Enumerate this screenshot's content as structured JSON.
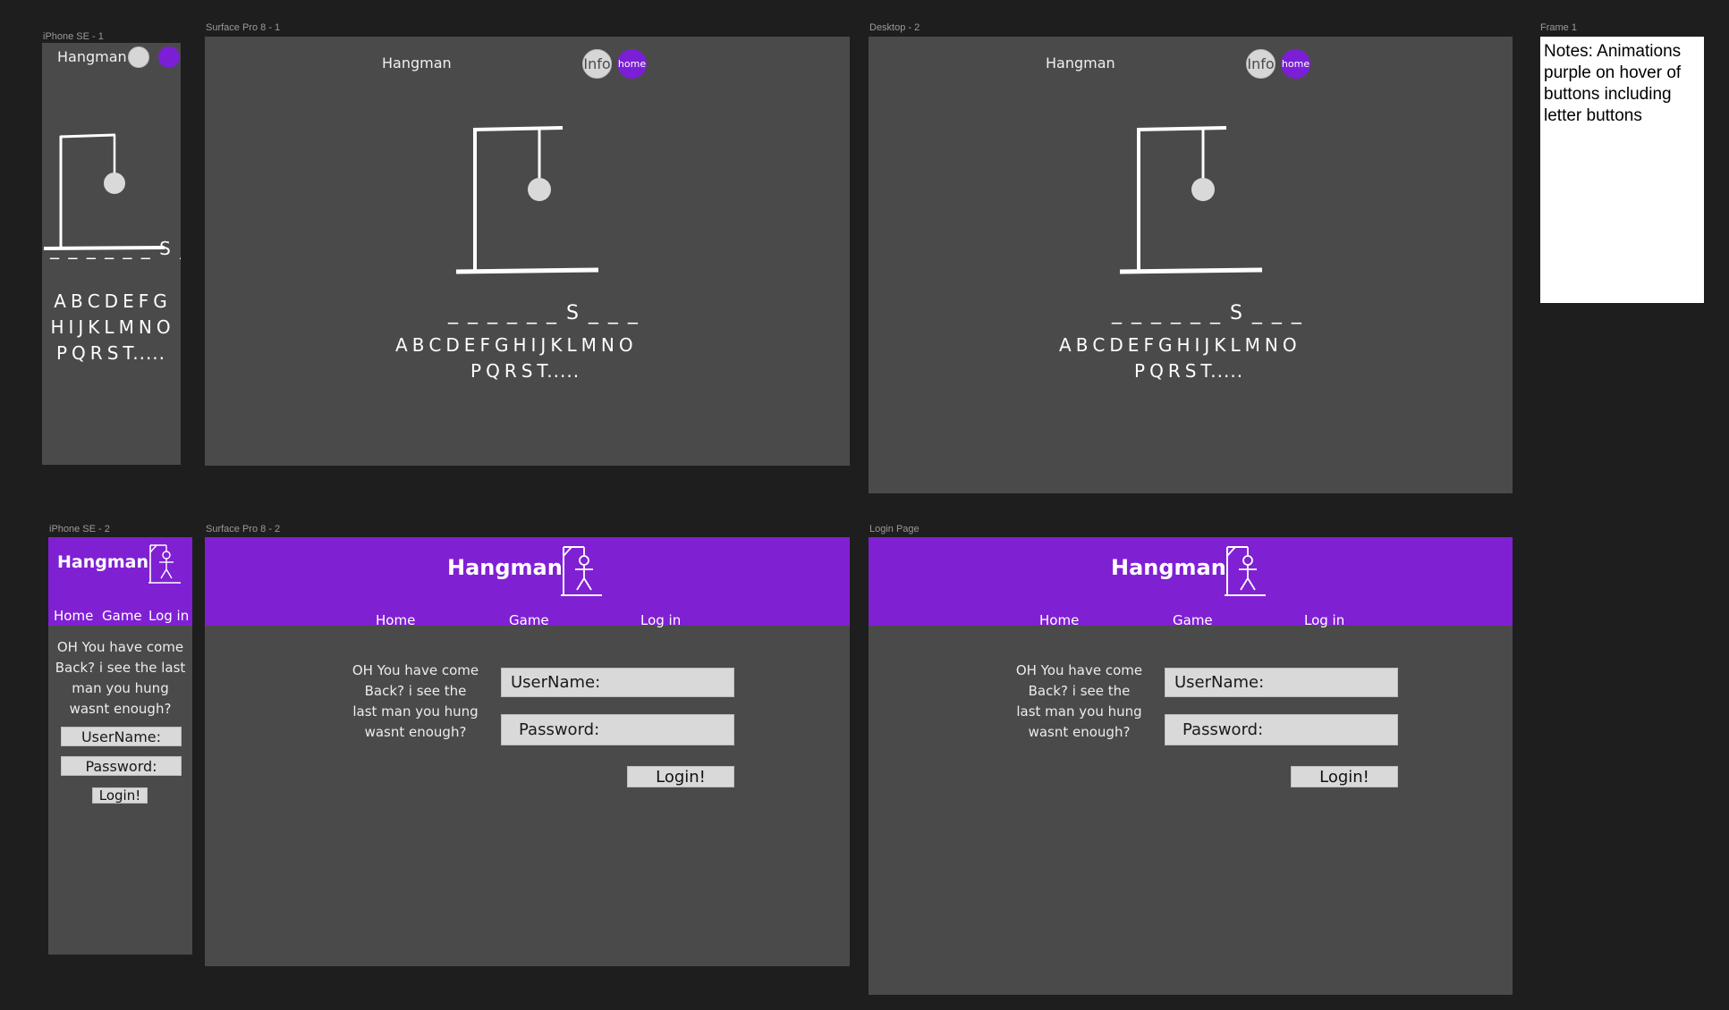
{
  "frames": {
    "iphone_se_1": "iPhone SE - 1",
    "surface_pro_8_1": "Surface Pro 8 - 1",
    "desktop_2": "Desktop - 2",
    "frame_1": "Frame 1",
    "iphone_se_2": "iPhone SE - 2",
    "surface_pro_8_2": "Surface Pro 8 - 2",
    "login_page": "Login Page"
  },
  "game": {
    "title": "Hangman",
    "info_label": "Info",
    "home_label": "home",
    "word_mobile": "_ _ _ _ _ _ S _",
    "word_large": "_ _ _ _ _ _ S _ _ _",
    "letters_mobile": [
      "A",
      "B",
      "C",
      "D",
      "E",
      "F",
      "G",
      "H",
      "I",
      "J",
      "K",
      "L",
      "M",
      "N",
      "O",
      "P",
      "Q",
      "R",
      "S",
      "T....."
    ],
    "letters_row1": [
      "A",
      "B",
      "C",
      "D",
      "E",
      "F",
      "G",
      "H",
      "I",
      "J",
      "K",
      "L",
      "M",
      "N",
      "O"
    ],
    "letters_row2": [
      "P",
      "Q",
      "R",
      "S",
      "T....."
    ]
  },
  "login": {
    "brand": "Hangman",
    "nav": {
      "home": "Home",
      "game": "Game",
      "login": "Log in"
    },
    "prompt": "OH You have come Back? i see the last man you hung wasnt enough?",
    "username_label": "UserName:",
    "password_label": "Password:",
    "submit_label": "Login!"
  },
  "notes": {
    "text": "Notes: Animations purple on hover of buttons including letter buttons"
  },
  "colors": {
    "canvas": "#1e1e1e",
    "frame": "#4a4a4a",
    "accent_purple": "#8020d3",
    "button_grey": "#d9d9d9"
  }
}
